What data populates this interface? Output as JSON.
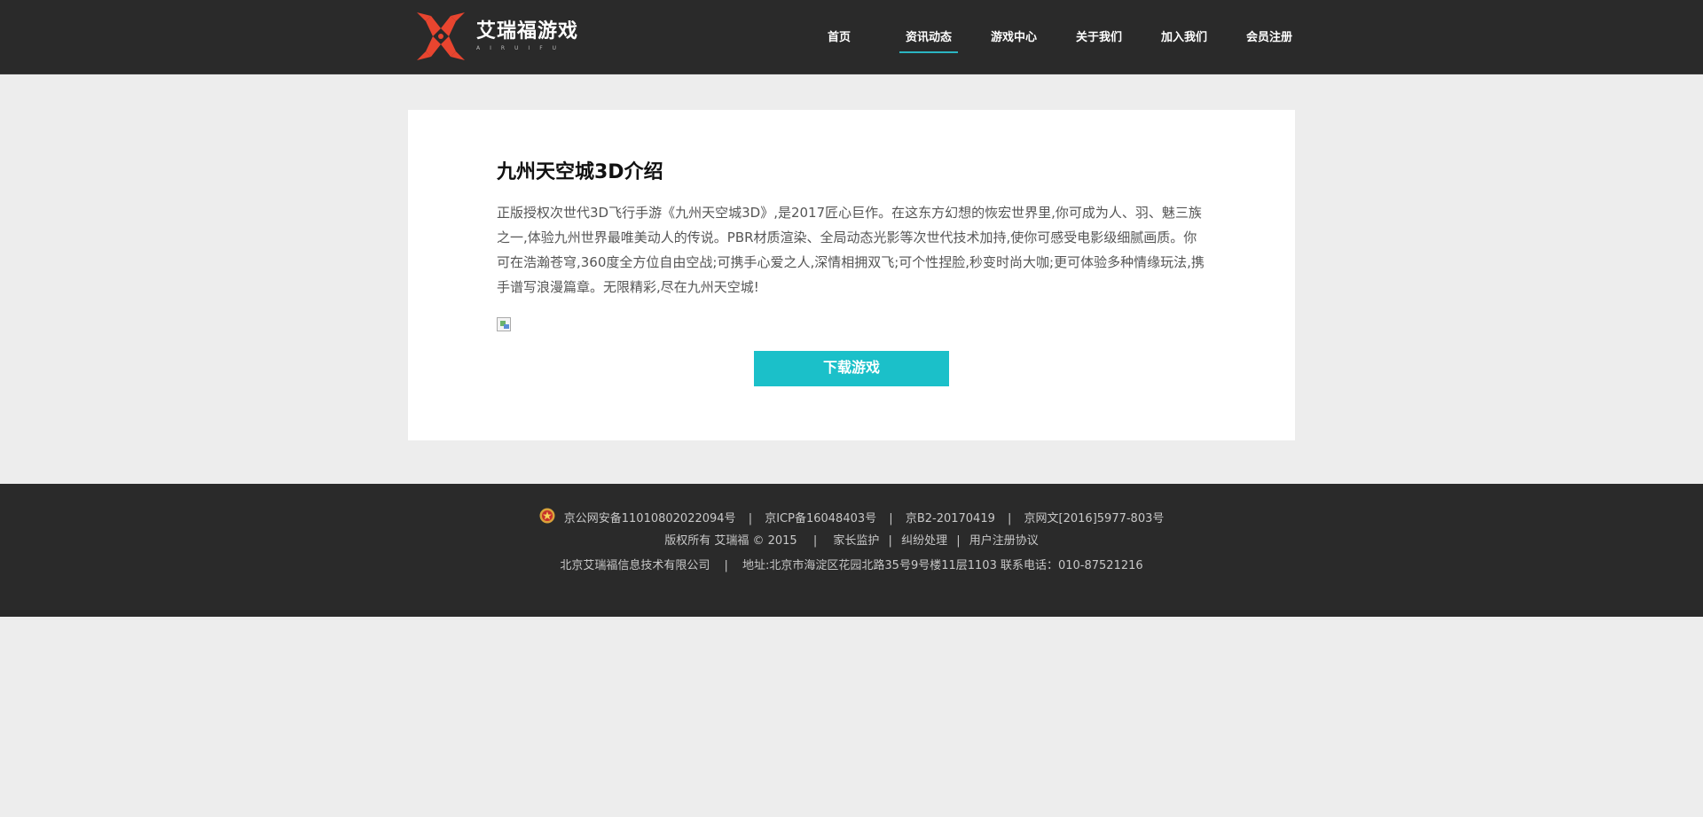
{
  "header": {
    "logo_text": "艾瑞福游戏",
    "logo_sub": "AIRUIFU",
    "nav": [
      {
        "label": "首页",
        "active": false
      },
      {
        "label": "资讯动态",
        "active": true
      },
      {
        "label": "游戏中心",
        "active": false
      },
      {
        "label": "关于我们",
        "active": false
      },
      {
        "label": "加入我们",
        "active": false
      },
      {
        "label": "会员注册",
        "active": false
      }
    ]
  },
  "article": {
    "title": "九州天空城3D介绍",
    "body": "正版授权次世代3D飞行手游《九州天空城3D》,是2017匠心巨作。在这东方幻想的恢宏世界里,你可成为人、羽、魅三族之一,体验九州世界最唯美动人的传说。PBR材质渲染、全局动态光影等次世代技术加持,使你可感受电影级细腻画质。你可在浩瀚苍穹,360度全方位自由空战;可携手心爱之人,深情相拥双飞;可个性捏脸,秒变时尚大咖;更可体验多种情缘玩法,携手谱写浪漫篇章。无限精彩,尽在九州天空城!",
    "download_label": "下载游戏"
  },
  "footer": {
    "line1": {
      "police": "京公网安备11010802022094号",
      "icp": "京ICP备16048403号",
      "b2": "京B2-20170419",
      "culture": "京网文[2016]5977-803号"
    },
    "line2": {
      "copyright": "版权所有 艾瑞福 © 2015",
      "links": [
        "家长监护",
        "纠纷处理",
        "用户注册协议"
      ]
    },
    "line3": {
      "company": "北京艾瑞福信息技术有限公司",
      "address": "地址:北京市海淀区花园北路35号9号楼11层1103 联系电话：010-87521216"
    }
  },
  "colors": {
    "header_bg": "#2a2a2a",
    "page_bg": "#ededed",
    "accent": "#1bc0c9",
    "logo_red": "#e8452f"
  }
}
